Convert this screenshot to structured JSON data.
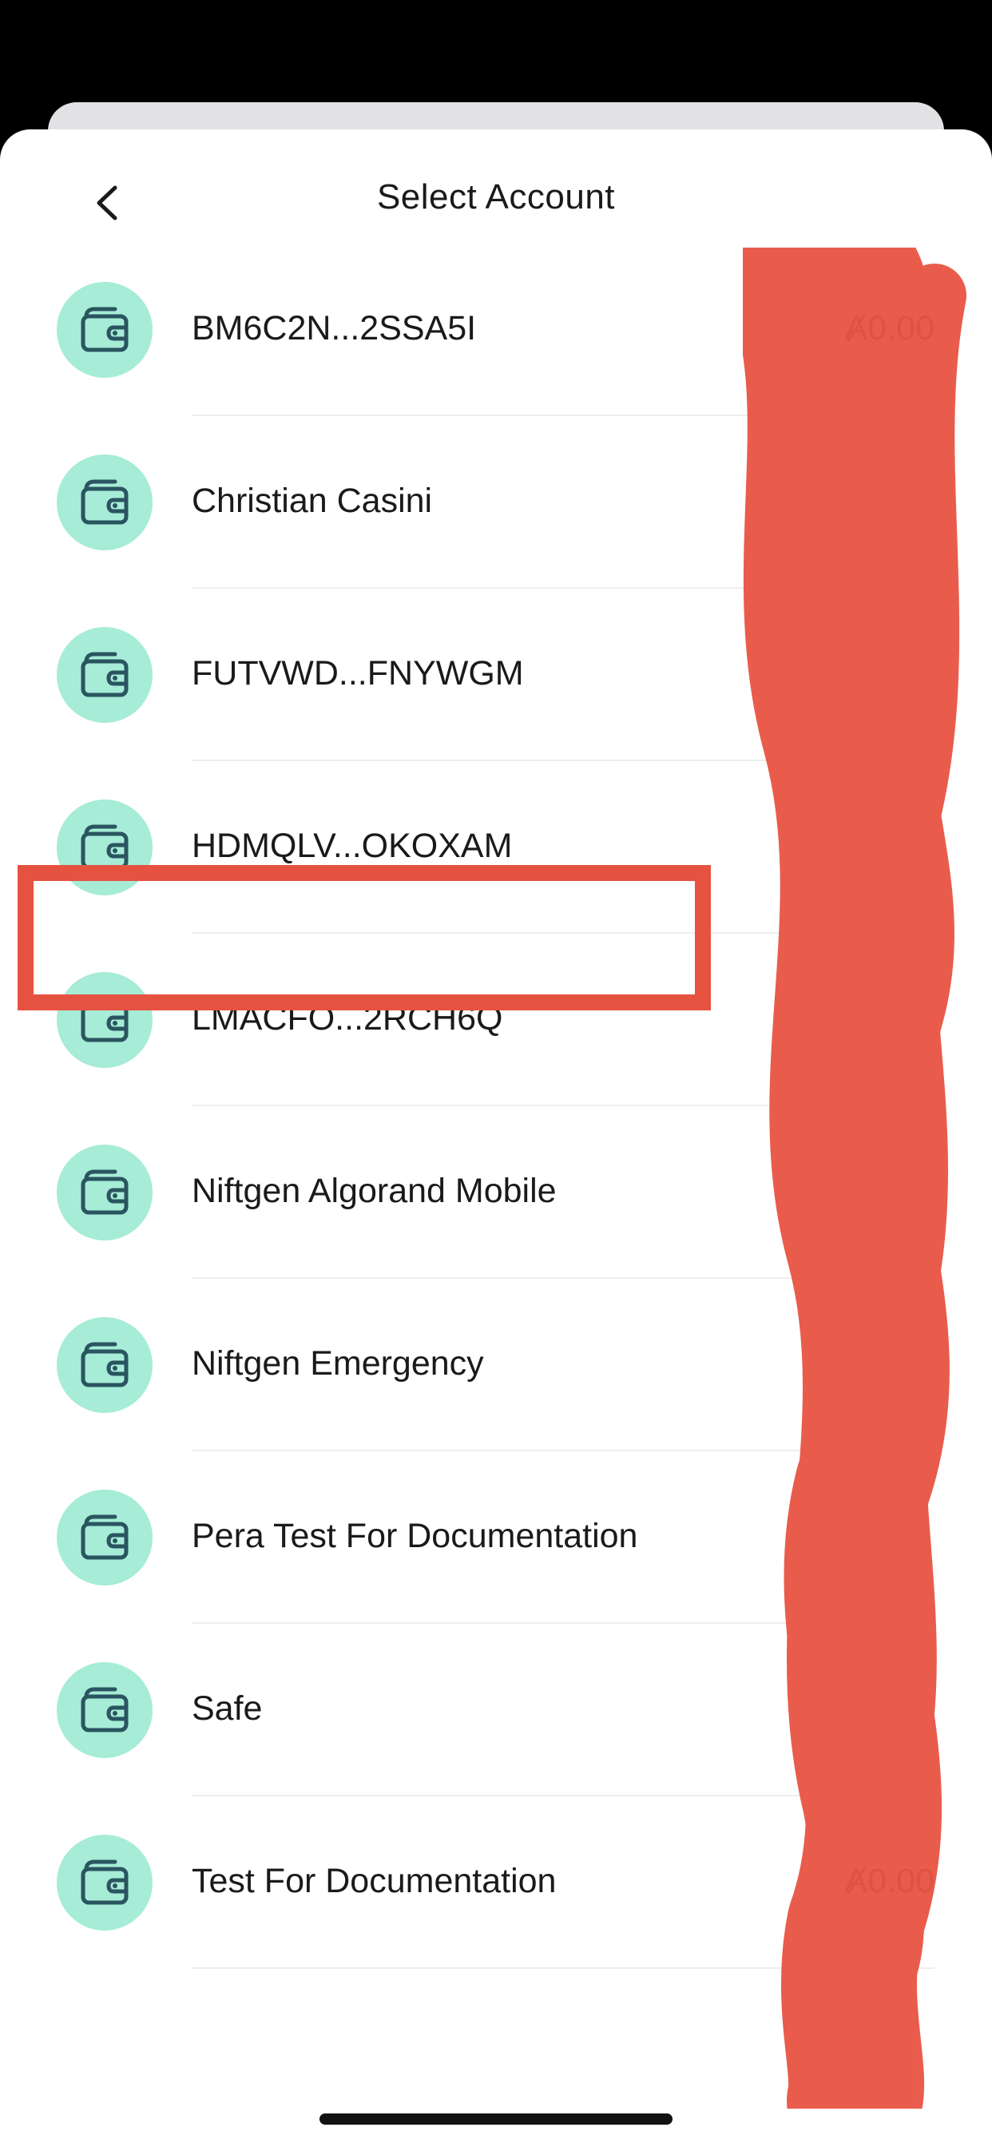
{
  "header": {
    "title": "Select Account",
    "back_icon": "chevron-left-icon"
  },
  "accounts": [
    {
      "name": "BM6C2N...2SSA5I",
      "balance": "Ⱥ0.00",
      "icon": "wallet-icon"
    },
    {
      "name": "Christian Casini",
      "balance": "",
      "icon": "wallet-icon"
    },
    {
      "name": "FUTVWD...FNYWGM",
      "balance": "",
      "icon": "wallet-icon"
    },
    {
      "name": "HDMQLV...OKOXAM",
      "balance": "",
      "icon": "wallet-icon",
      "highlighted": true
    },
    {
      "name": "LMACFO...2RCH6Q",
      "balance": "",
      "icon": "wallet-icon"
    },
    {
      "name": "Niftgen Algorand Mobile",
      "balance": "",
      "icon": "wallet-icon"
    },
    {
      "name": "Niftgen Emergency",
      "balance": "",
      "icon": "wallet-icon"
    },
    {
      "name": "Pera Test For Documentation",
      "balance": "",
      "icon": "wallet-icon"
    },
    {
      "name": "Safe",
      "balance": "",
      "icon": "wallet-icon"
    },
    {
      "name": "Test For Documentation",
      "balance": "Ⱥ0.00",
      "icon": "wallet-icon"
    }
  ],
  "colors": {
    "avatar_bg": "#a6ecd6",
    "icon_stroke": "#2a5560",
    "highlight": "#e65240",
    "redaction": "#e8503f"
  }
}
